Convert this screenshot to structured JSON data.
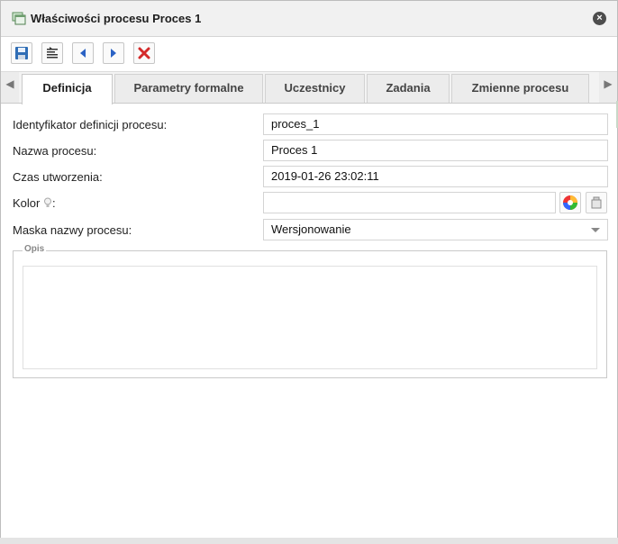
{
  "dialog": {
    "title": "Właściwości procesu Proces 1"
  },
  "toolbar": {
    "buttons": [
      "save",
      "format",
      "prev",
      "next",
      "delete"
    ]
  },
  "tabs": {
    "items": [
      {
        "label": "Definicja"
      },
      {
        "label": "Parametry formalne"
      },
      {
        "label": "Uczestnicy"
      },
      {
        "label": "Zadania"
      },
      {
        "label": "Zmienne procesu"
      }
    ],
    "scroll_left": "◀",
    "scroll_right": "▶"
  },
  "form": {
    "id_label": "Identyfikator definicji procesu:",
    "id_value": "proces_1",
    "name_label": "Nazwa procesu:",
    "name_value": "Proces 1",
    "created_label": "Czas utworzenia:",
    "created_value": "2019-01-26 23:02:11",
    "color_label_before": "Kolor",
    "color_label_after": ":",
    "color_value": "",
    "mask_label": "Maska nazwy procesu:",
    "mask_value": "Wersjonowanie"
  },
  "opis": {
    "legend": "Opis",
    "value": ""
  }
}
